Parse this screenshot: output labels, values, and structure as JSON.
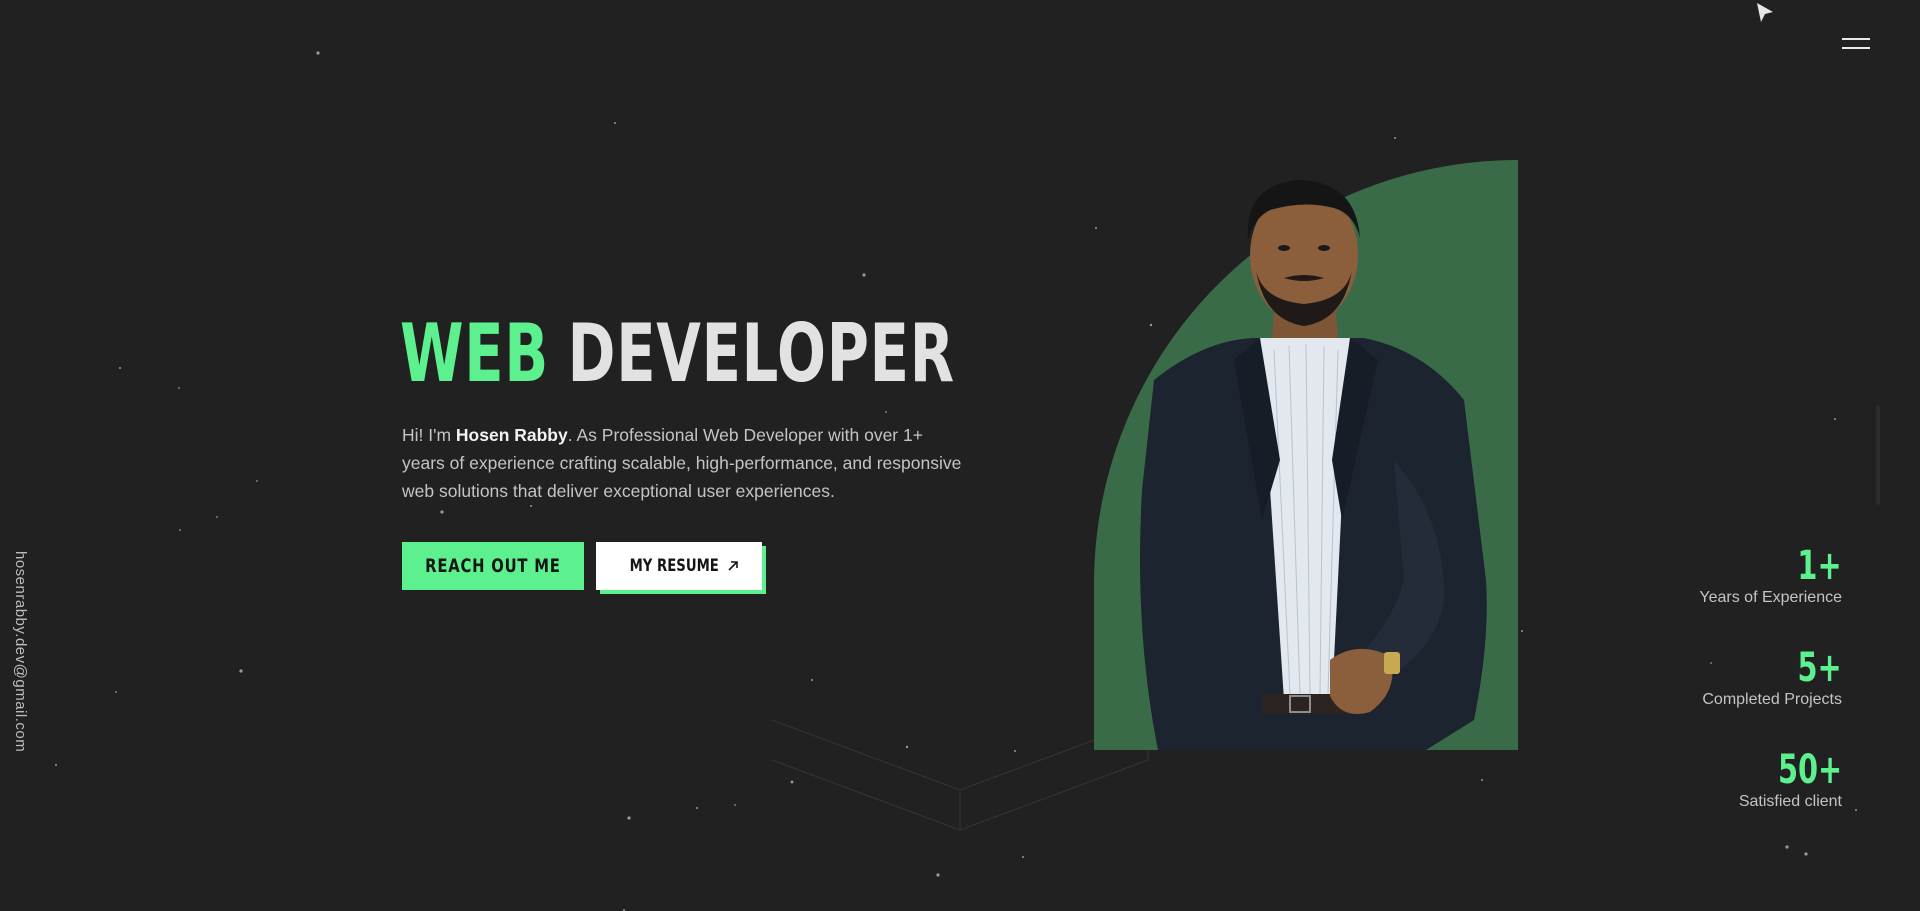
{
  "hero": {
    "title_accent": "WEB",
    "title_main": "DEVELOPER",
    "intro_prefix": "Hi! I'm ",
    "intro_name": "Hosen Rabby",
    "intro_suffix": ". As Professional Web Developer with over 1+ years of experience crafting scalable, high-performance, and responsive web solutions that deliver exceptional user experiences."
  },
  "buttons": {
    "reach_out": "REACH OUT ME",
    "resume": "MY RESUME"
  },
  "icons": {
    "menu": "hamburger-menu-icon",
    "resume_arrow": "arrow-up-right-icon",
    "cursor": "mouse-cursor-icon"
  },
  "sidebar": {
    "email": "hosenrabby.dev@gmail.com"
  },
  "stats": [
    {
      "value": "1+",
      "label": "Years of Experience"
    },
    {
      "value": "5+",
      "label": "Completed Projects"
    },
    {
      "value": "50+",
      "label": "Satisfied client"
    }
  ],
  "colors": {
    "background": "#212121",
    "accent": "#5cf08e",
    "photo_backdrop": "#3a6b48",
    "text": "#c4c4c4"
  }
}
